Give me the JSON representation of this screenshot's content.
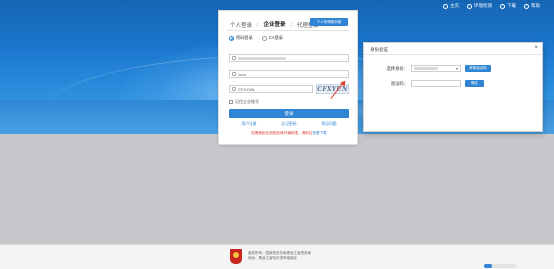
{
  "topnav": [
    {
      "icon": "home-icon",
      "label": "主页"
    },
    {
      "icon": "globe-icon",
      "label": "环境检测"
    },
    {
      "icon": "download-icon",
      "label": "下载"
    },
    {
      "icon": "help-icon",
      "label": "帮助"
    }
  ],
  "login": {
    "tabs": [
      "个人登录",
      "企业登录",
      "代理登录"
    ],
    "active_tab": "企业登录",
    "cta_label": "个人所得税申报",
    "radios": [
      {
        "label": "密码登录",
        "checked": true
      },
      {
        "label": "CA登录",
        "checked": false
      }
    ],
    "password_mask": "••••••",
    "captcha_value": "CFXYUN",
    "captcha_image_text": "CFXYUN",
    "remember_label": "记住企业账号",
    "login_button": "登录",
    "links": [
      "用户注册",
      "忘记密码",
      "常见问题"
    ],
    "warning_text": "如需使用应到税务局开通权限，请前往",
    "warning_link": "查看下载"
  },
  "dialog": {
    "title": "身份验证",
    "close_glyph": "×",
    "select_label": "选择身份：",
    "select_chevron": "▾",
    "send_button": "获取验证码",
    "code_label": "验证码：",
    "confirm_button": "确定"
  },
  "footer": {
    "line1": "版权所有：国家税务总局黑龙江省税务局",
    "line2": "地址：黑龙江省哈尔滨市南岗区"
  },
  "colors": {
    "accent": "#2f84d4",
    "arrow": "#e23d2d",
    "warning": "#d63a2c"
  }
}
